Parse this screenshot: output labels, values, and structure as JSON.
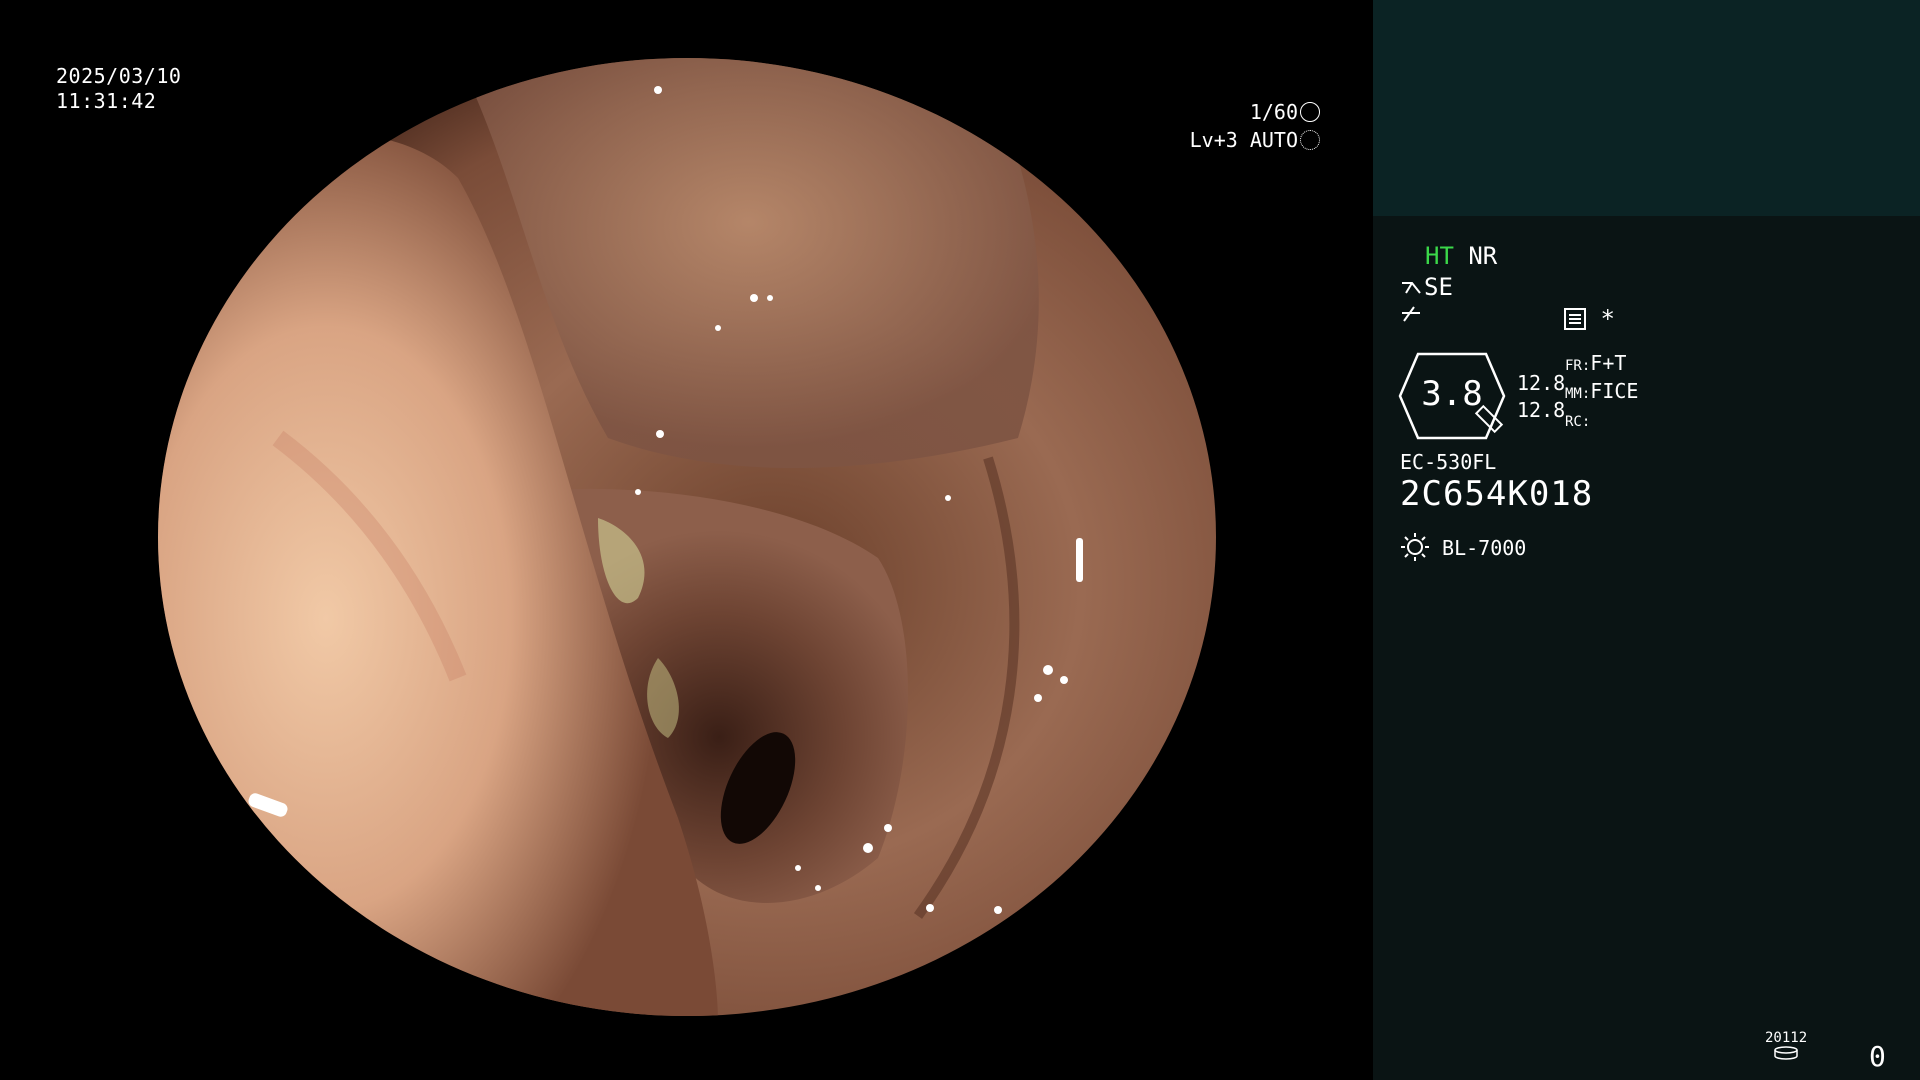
{
  "overlay": {
    "date": "2025/03/10",
    "time": "11:31:42",
    "shutter": "1/60",
    "level": "Lv+3",
    "iris_mode": "AUTO"
  },
  "panel": {
    "ht": "HT",
    "nr": "NR",
    "se": "SE",
    "star": "*",
    "zoom_value": "3.8",
    "value_top": "12.8",
    "value_bottom": "12.8",
    "fr_label": "FR:",
    "fr_value": "F+T",
    "mm_label": "MM:",
    "mm_value": "FICE",
    "rc_label": "RC:",
    "scope_model": "EC-530FL",
    "scope_serial": "2C654K018",
    "light_source": "BL-7000",
    "storage_label": "20112",
    "counter": "0"
  },
  "colors": {
    "ht_green": "#3bd84a",
    "panel_bg": "#0a1414",
    "panel_top_bg": "#0b2324"
  },
  "icons": [
    "shutter-icon",
    "iris-icon",
    "scissor-icon",
    "lightning-icon",
    "menu-icon",
    "light-source-icon",
    "storage-icon"
  ]
}
